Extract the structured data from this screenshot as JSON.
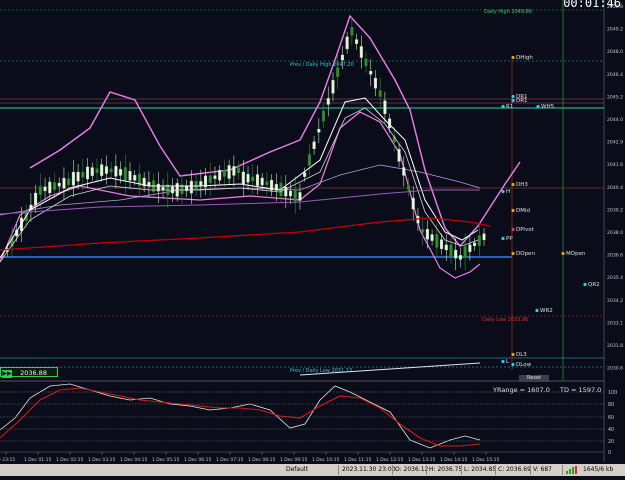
{
  "chart": {
    "countdown": "00:01:46",
    "current_price": "2036.88",
    "range_label": "YRange = 1607.0",
    "td_label": "TD = 1597.0",
    "price_ticks": [
      "2050.8",
      "2049.2",
      "2048.0",
      "2046.4",
      "2045.2",
      "2044.0",
      "2042.9",
      "2041.6",
      "2040.4",
      "2039.2",
      "2038.0",
      "2036.6",
      "2035.4",
      "2034.2",
      "2033.1",
      "2031.8",
      "2030.6"
    ],
    "oscillator_ticks": [
      "100",
      "80",
      "60",
      "40",
      "20",
      "0"
    ],
    "time_labels": [
      "Nov 23:15",
      "1 Dec 01:15",
      "1 Dec 02:15",
      "1 Dec 03:15",
      "1 Dec 04:15",
      "1 Dec 05:15",
      "1 Dec 06:15",
      "1 Dec 07:15",
      "1 Dec 08:15",
      "1 Dec 09:15",
      "1 Dec 10:15",
      "1 Dec 11:15",
      "1 Dec 12:15",
      "1 Dec 13:15",
      "1 Dec 14:15",
      "1 Dec 15:15"
    ],
    "levels": {
      "daily_high": "Daily High 2049.86",
      "prev_daily_high": "Prev / Daily High 2047.20",
      "daily_low": "Daily Low 2033.86",
      "prev_daily_low": "Prev / Daily Low 2031.13"
    },
    "markers": [
      "DHigh",
      "DR1",
      "DR1",
      "R1",
      "WH5",
      "H",
      "DH3",
      "DMid",
      "DPivot",
      "PP",
      "DOpen",
      "MOpen",
      "QR2",
      "WR2",
      "DL3",
      "L",
      "DLow"
    ],
    "reset_button": "Reset"
  },
  "statusbar": {
    "profile": "Default",
    "datetime": "2023.11.30 23:00",
    "open": "O: 2036.12",
    "high": "H: 2036.75",
    "low": "L: 2034.85",
    "close": "C: 2036.69",
    "volume": "V: 687",
    "traffic": "1645/6 kb"
  },
  "colors": {
    "background": "#0b0c1a",
    "bull_candle": "#e8f5e0",
    "bear_candle": "#2e8b2e",
    "bollinger": "#ee7fe8",
    "ma_white": "#ffffff",
    "ma_red": "#c40000",
    "level_blue": "#2a7fff",
    "level_teal": "#20d4a0",
    "osc_white": "#e6e6e6",
    "osc_red": "#d11a1a"
  }
}
